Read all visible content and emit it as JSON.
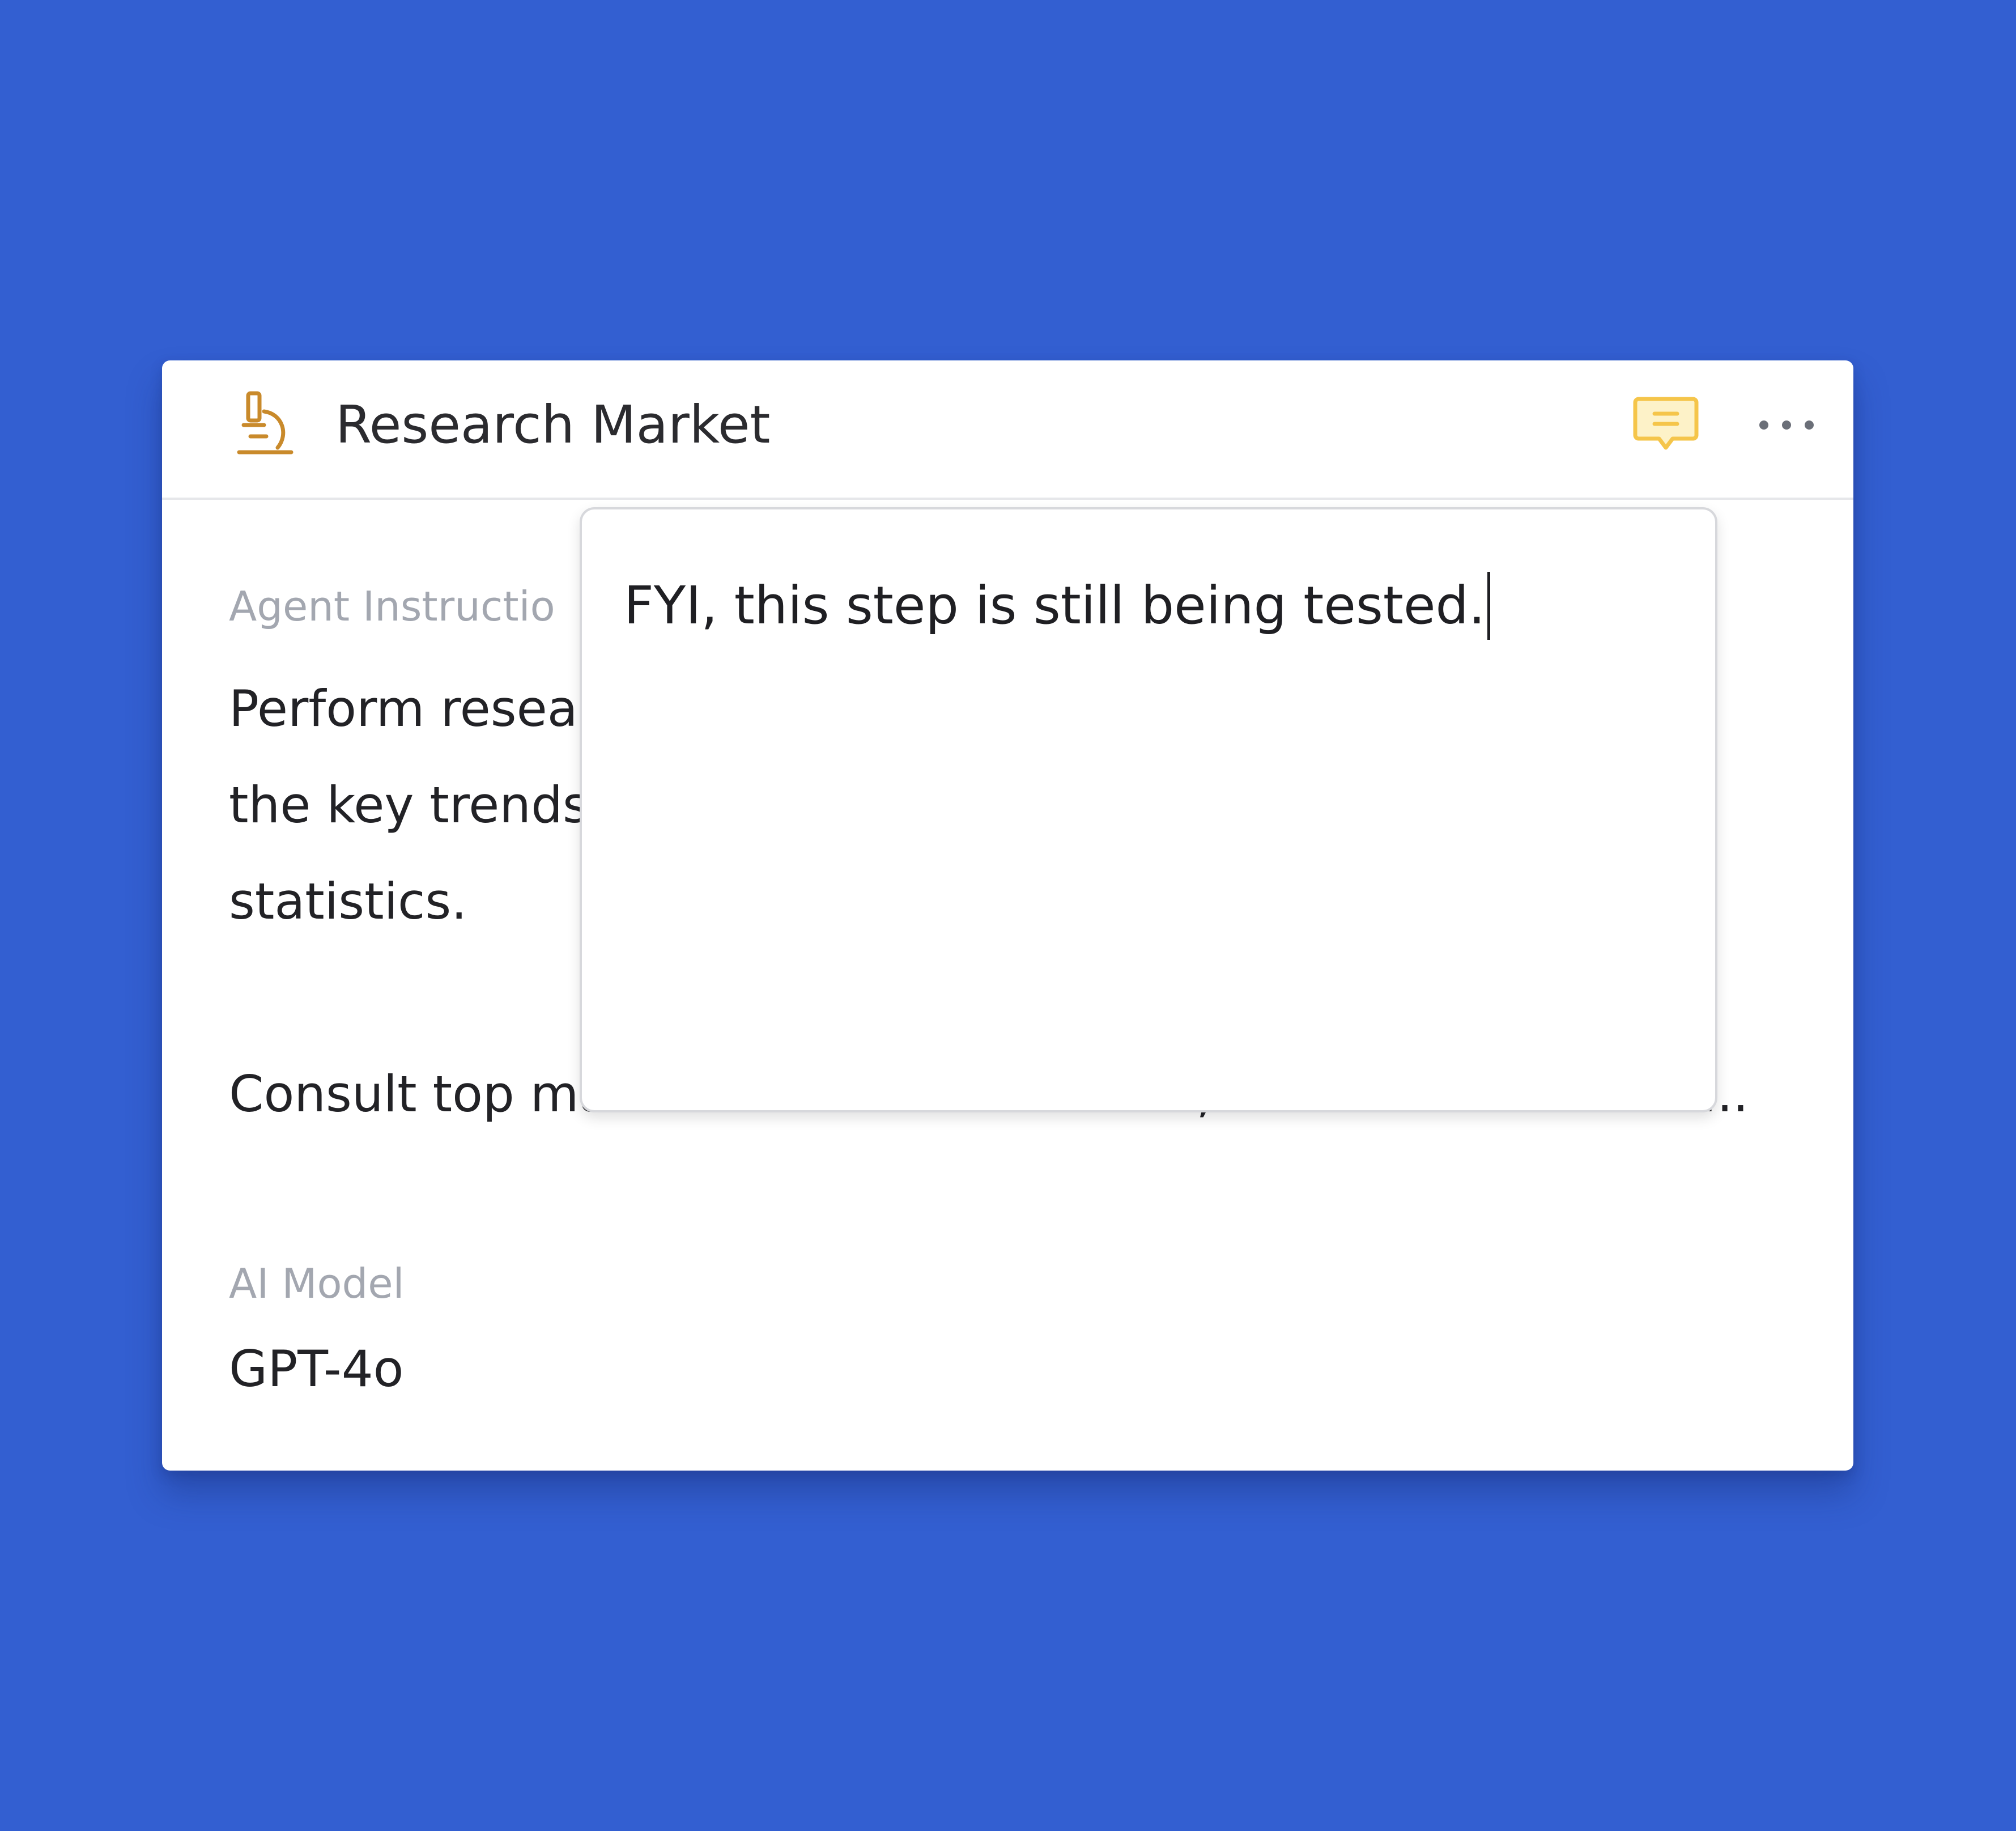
{
  "colors": {
    "background": "#335fd1",
    "card": "#ffffff",
    "icon_accent": "#c98a2b",
    "comment_accent": "#f5c54a"
  },
  "header": {
    "title": "Research Market",
    "step_icon": "microscope-icon",
    "comment_icon": "comment-icon",
    "more_icon": "more-horizontal-icon"
  },
  "instructions": {
    "label": "Agent Instructio",
    "lines": [
      "Perform resear",
      "the key trends",
      "statistics.",
      "Consult top market research resources, statistics websites ..."
    ]
  },
  "model": {
    "label": "AI Model",
    "value": "GPT-4o"
  },
  "comment_popover": {
    "text": "FYI, this step is still being tested."
  }
}
